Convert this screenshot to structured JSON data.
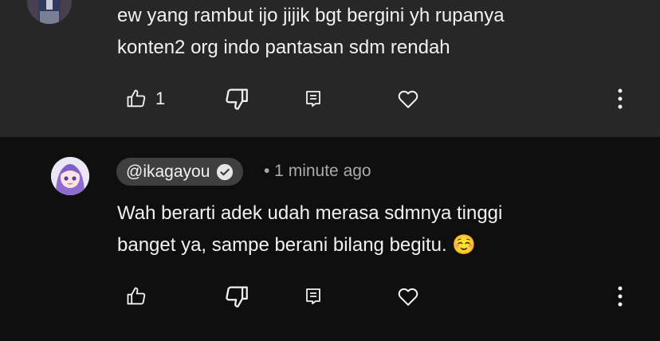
{
  "comments": [
    {
      "text_lines": [
        "ew yang rambut ijo jijik bgt  bergini yh rupanya",
        "konten2 org indo pantasan sdm rendah"
      ],
      "like_count": "1"
    },
    {
      "author": "@ikagayou",
      "verified": true,
      "time": "• 1 minute ago",
      "text_lines": [
        "Wah berarti adek udah merasa sdmnya tinggi",
        "banget ya, sampe berani bilang begitu. ☺️"
      ]
    }
  ],
  "icons": [
    "like-icon",
    "dislike-icon",
    "reply-icon",
    "heart-icon",
    "more-vert-icon",
    "verified-icon"
  ],
  "colors": {
    "top_comment_bg": "#272727",
    "page_bg": "#0f0f0f",
    "text": "#f1f1f1",
    "secondary_text": "#aaaaaa",
    "author_chip_bg": "#3f3f3f"
  }
}
